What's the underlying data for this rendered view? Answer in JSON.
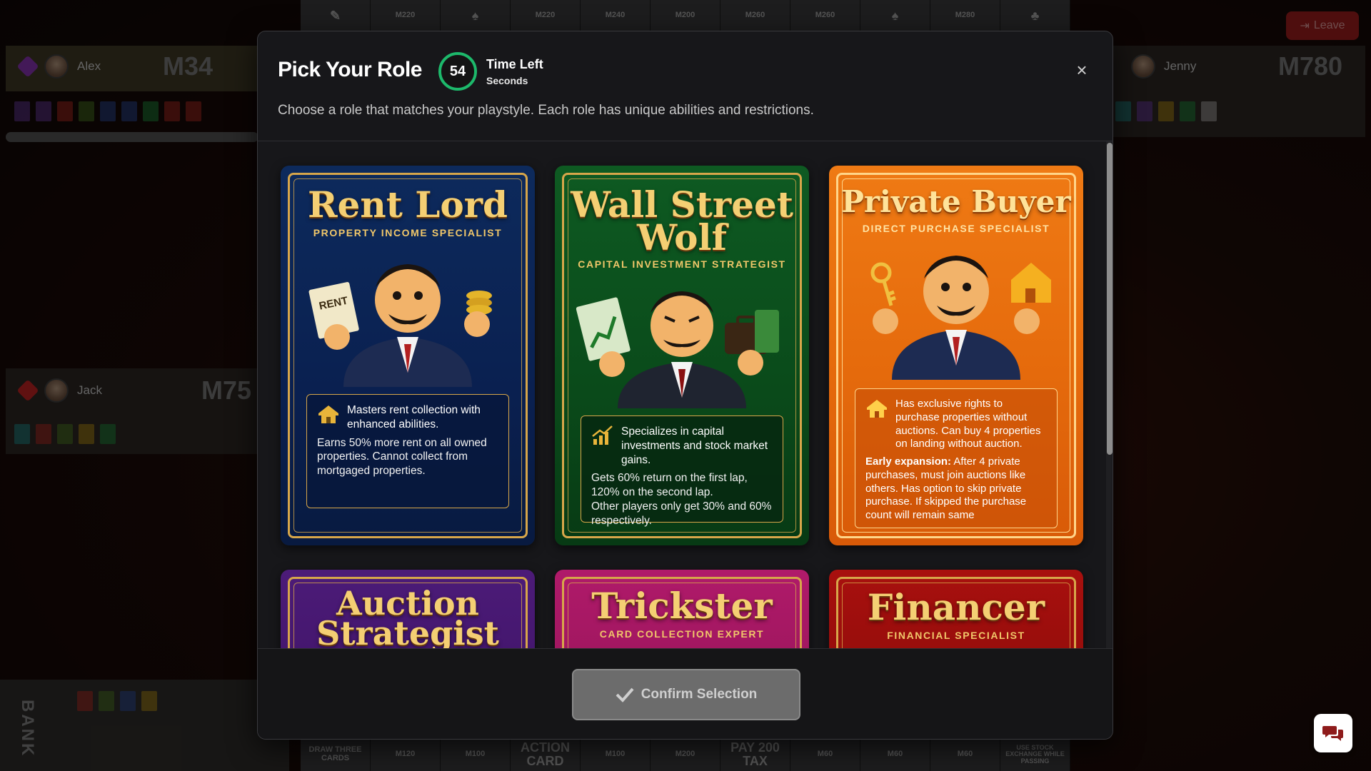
{
  "board": {
    "top_tiles": [
      "",
      "M220",
      "",
      "M220",
      "M240",
      "M200",
      "M260",
      "M260",
      "",
      "M280",
      ""
    ],
    "bottom_tiles": [
      "DRAW THREE CARDS",
      "M120",
      "M100",
      "ACTION CARD",
      "M100",
      "M200",
      "PAY 200 TAX",
      "M60",
      "M60",
      "M60",
      "USE STOCK EXCHANGE WHILE PASSING"
    ]
  },
  "players": {
    "alex": {
      "name": "Alex",
      "money": "M34"
    },
    "jenny": {
      "name": "Jenny",
      "money": "M780"
    },
    "jack": {
      "name": "Jack",
      "money": "M75"
    }
  },
  "leave_label": "Leave",
  "bank_label": "BANK",
  "modal": {
    "title": "Pick Your Role",
    "timer_value": "54",
    "timer_label": "Time Left",
    "timer_unit": "Seconds",
    "subtitle": "Choose a role that matches your playstyle. Each role has unique abilities and restrictions.",
    "confirm_label": "Confirm Selection",
    "close_icon": "close-icon"
  },
  "roles": [
    {
      "title_line1": "Rent Lord",
      "subtitle": "PROPERTY INCOME SPECIALIST",
      "head": "Masters rent collection with enhanced abilities.",
      "body": "Earns 50% more rent on all owned properties. Cannot collect from mortgaged properties.",
      "sign": "RENT"
    },
    {
      "title_line1": "Wall Street",
      "title_line2": "Wolf",
      "subtitle": "CAPITAL INVESTMENT STRATEGIST",
      "head": "Specializes in capital investments and stock market gains.",
      "body": "Gets 60% return on the first lap, 120% on the second lap.",
      "body2": "Other players only get 30% and 60% respectively."
    },
    {
      "title_line1": "Private Buyer",
      "subtitle": "DIRECT PURCHASE SPECIALIST",
      "head": "Has exclusive rights to purchase properties without auctions. Can buy 4 properties on landing without auction.",
      "note_label": "Early expansion:",
      "note_text": " After 4 private purchases, must join auctions like others. Has option to skip private purchase. If skipped the purchase count will remain same"
    },
    {
      "title_line1": "Auction",
      "title_line2": "Strategist"
    },
    {
      "title_line1": "Trickster",
      "subtitle": "CARD COLLECTION EXPERT"
    },
    {
      "title_line1": "Financer",
      "subtitle": "FINANCIAL SPECIALIST"
    }
  ],
  "colors": {
    "timer_ring": "#1db96b",
    "leave_bg": "#8e1b1b",
    "card_gold": "#d7a64a"
  }
}
